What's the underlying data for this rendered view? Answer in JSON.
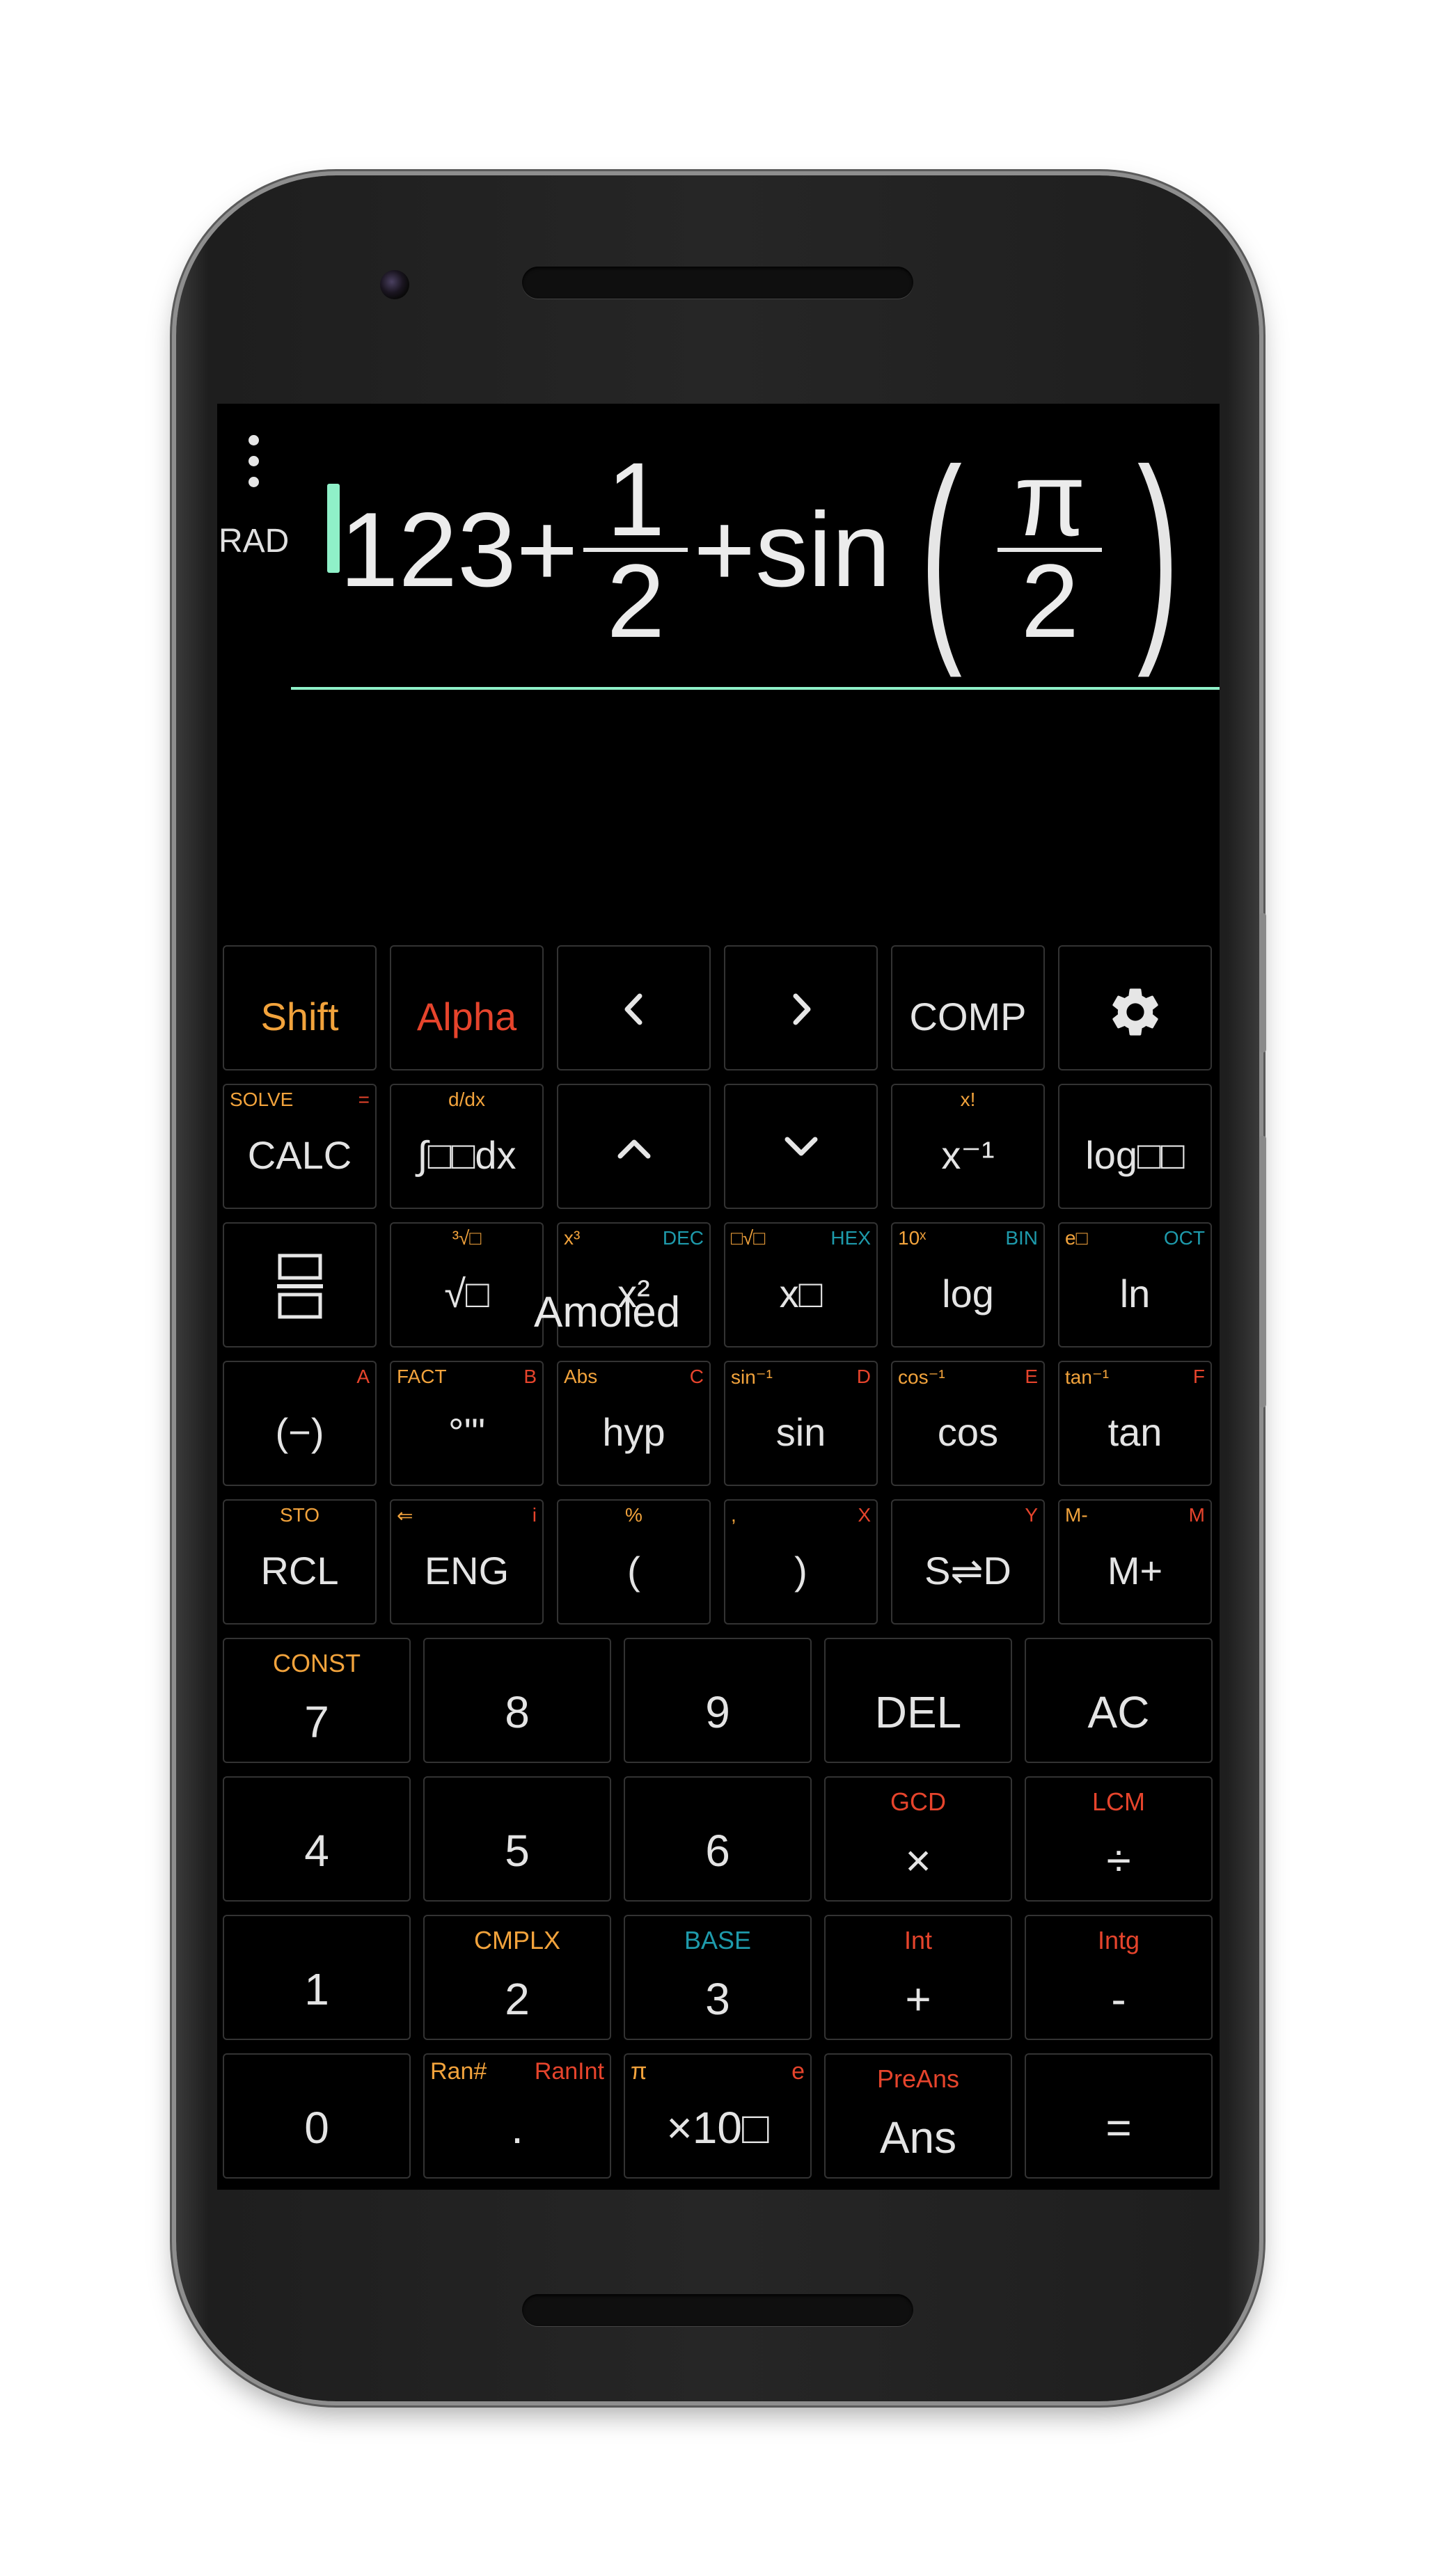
{
  "display": {
    "mode": "RAD",
    "expression": {
      "lead": "123+",
      "frac1_num": "1",
      "frac1_den": "2",
      "middle": "+sin",
      "frac2_num": "π",
      "frac2_den": "2"
    }
  },
  "overlay_label": "Amoled",
  "rows": [
    [
      {
        "name": "shift-key",
        "main": "Shift",
        "main_color": "orange"
      },
      {
        "name": "alpha-key",
        "main": "Alpha",
        "main_color": "red"
      },
      {
        "name": "cursor-left-key",
        "icon": "chevron-left-icon"
      },
      {
        "name": "cursor-right-key",
        "icon": "chevron-right-icon"
      },
      {
        "name": "comp-mode-key",
        "main": "COMP"
      },
      {
        "name": "settings-key",
        "icon": "gear-icon"
      }
    ],
    [
      {
        "name": "calc-key",
        "main": "CALC",
        "tl": "SOLVE",
        "tr": "="
      },
      {
        "name": "integral-key",
        "main": "∫□□dx",
        "tc": "d/dx"
      },
      {
        "name": "cursor-up-key",
        "icon": "chevron-up-icon"
      },
      {
        "name": "cursor-down-key",
        "icon": "chevron-down-icon"
      },
      {
        "name": "inverse-key",
        "main": "x⁻¹",
        "tc": "x!"
      },
      {
        "name": "log-base-key",
        "main": "log□□"
      }
    ],
    [
      {
        "name": "fraction-key",
        "icon": "fraction-icon"
      },
      {
        "name": "sqrt-key",
        "main": "√□",
        "tc": "³√□"
      },
      {
        "name": "square-key",
        "main": "x²",
        "tl": "x³",
        "tr": "DEC",
        "tr_color": "teal"
      },
      {
        "name": "power-key",
        "main": "x□",
        "tl": "□√□",
        "tr": "HEX",
        "tr_color": "teal"
      },
      {
        "name": "log-key",
        "main": "log",
        "tl": "10ˣ",
        "tr": "BIN",
        "tr_color": "teal"
      },
      {
        "name": "ln-key",
        "main": "ln",
        "tl": "e□",
        "tr": "OCT",
        "tr_color": "teal"
      }
    ],
    [
      {
        "name": "negative-key",
        "main": "(−)",
        "tr": "A"
      },
      {
        "name": "degree-key",
        "main": "°'\"",
        "tl": "FACT",
        "tr": "B"
      },
      {
        "name": "hyp-key",
        "main": "hyp",
        "tl": "Abs",
        "tr": "C"
      },
      {
        "name": "sin-key",
        "main": "sin",
        "tl": "sin⁻¹",
        "tr": "D"
      },
      {
        "name": "cos-key",
        "main": "cos",
        "tl": "cos⁻¹",
        "tr": "E"
      },
      {
        "name": "tan-key",
        "main": "tan",
        "tl": "tan⁻¹",
        "tr": "F"
      }
    ],
    [
      {
        "name": "rcl-key",
        "main": "RCL",
        "tc": "STO"
      },
      {
        "name": "eng-key",
        "main": "ENG",
        "tl": "⇐",
        "tr": "i"
      },
      {
        "name": "open-paren-key",
        "main": "(",
        "tc": "%"
      },
      {
        "name": "close-paren-key",
        "main": ")",
        "tl": ",",
        "tr": "X"
      },
      {
        "name": "s-d-key",
        "main": "S⇌D",
        "tr": "Y"
      },
      {
        "name": "m-plus-key",
        "main": "M+",
        "tl": "M-",
        "tr": "M"
      }
    ],
    [
      {
        "name": "digit-7-key",
        "main": "7",
        "top": "CONST",
        "top_color": "orange"
      },
      {
        "name": "digit-8-key",
        "main": "8"
      },
      {
        "name": "digit-9-key",
        "main": "9"
      },
      {
        "name": "del-key",
        "main": "DEL"
      },
      {
        "name": "ac-key",
        "main": "AC"
      }
    ],
    [
      {
        "name": "digit-4-key",
        "main": "4"
      },
      {
        "name": "digit-5-key",
        "main": "5"
      },
      {
        "name": "digit-6-key",
        "main": "6"
      },
      {
        "name": "multiply-key",
        "main": "×",
        "top": "GCD",
        "top_color": "red"
      },
      {
        "name": "divide-key",
        "main": "÷",
        "top": "LCM",
        "top_color": "red"
      }
    ],
    [
      {
        "name": "digit-1-key",
        "main": "1"
      },
      {
        "name": "digit-2-key",
        "main": "2",
        "top": "CMPLX",
        "top_color": "orange"
      },
      {
        "name": "digit-3-key",
        "main": "3",
        "top": "BASE",
        "top_color": "teal"
      },
      {
        "name": "plus-key",
        "main": "+",
        "top": "Int",
        "top_color": "red"
      },
      {
        "name": "minus-key",
        "main": "-",
        "top": "Intg",
        "top_color": "red"
      }
    ],
    [
      {
        "name": "digit-0-key",
        "main": "0"
      },
      {
        "name": "decimal-key",
        "main": ".",
        "tl": "Ran#",
        "tr": "RanInt",
        "tl_color": "orange"
      },
      {
        "name": "times-ten-power-key",
        "main": "×10□",
        "tl": "π",
        "tr": "e"
      },
      {
        "name": "ans-key",
        "main": "Ans",
        "top": "PreAns",
        "top_color": "red"
      },
      {
        "name": "equals-key",
        "main": "="
      }
    ]
  ]
}
